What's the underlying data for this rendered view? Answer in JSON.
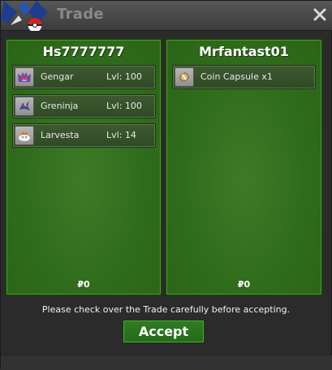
{
  "window": {
    "title": "Trade",
    "close_icon": "close-icon"
  },
  "left_panel": {
    "title": "Hs7777777",
    "items": [
      {
        "name": "Gengar",
        "level": "Lvl: 100",
        "icon": "gengar-icon"
      },
      {
        "name": "Greninja",
        "level": "Lvl: 100",
        "icon": "greninja-icon"
      },
      {
        "name": "Larvesta",
        "level": "Lvl: 14",
        "icon": "larvesta-icon"
      }
    ],
    "money": "₽0"
  },
  "right_panel": {
    "title": "Mrfantast01",
    "items": [
      {
        "name": "Coin Capsule  x1",
        "icon": "coin-capsule-icon"
      }
    ],
    "money": "₽0"
  },
  "notice": "Please check over the Trade carefully before accepting.",
  "accept_button": "Accept",
  "colors": {
    "panel_green": "#2f6c1c",
    "accept_green": "#2f7d22",
    "title_gray": "#8a8a8a"
  }
}
